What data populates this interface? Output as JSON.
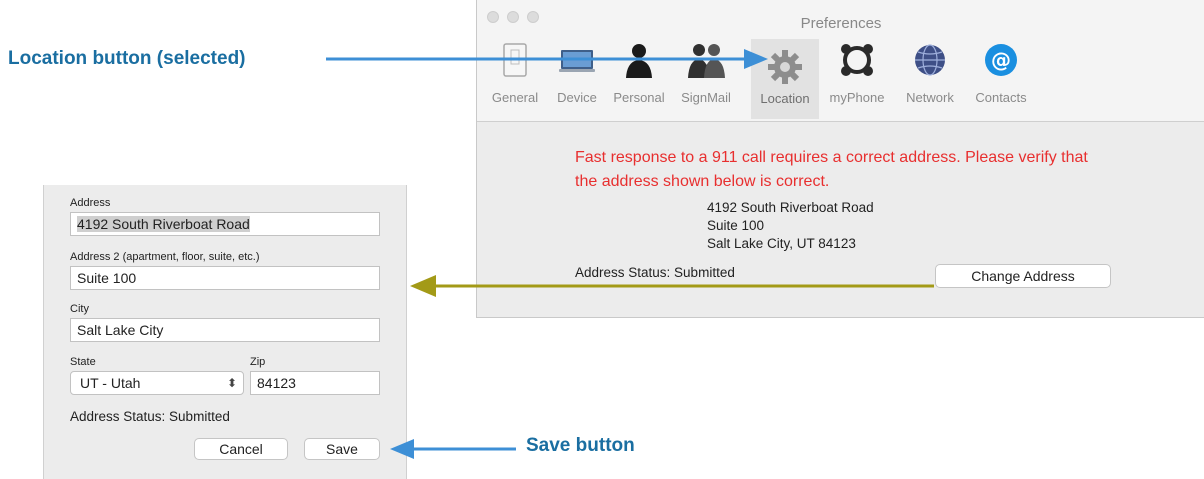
{
  "callouts": {
    "location_label": "Location button (selected)",
    "save_label": "Save button"
  },
  "preferences": {
    "title": "Preferences",
    "toolbar": [
      {
        "label": "General",
        "icon": "general-icon"
      },
      {
        "label": "Device",
        "icon": "device-icon"
      },
      {
        "label": "Personal",
        "icon": "personal-icon"
      },
      {
        "label": "SignMail",
        "icon": "signmail-icon"
      },
      {
        "label": "Location",
        "icon": "gear-icon",
        "selected": true
      },
      {
        "label": "myPhone",
        "icon": "myphone-icon"
      },
      {
        "label": "Network",
        "icon": "globe-icon"
      },
      {
        "label": "Contacts",
        "icon": "at-sign-icon"
      }
    ],
    "warning": "Fast response to a 911 call requires a correct address.  Please verify that the address shown below is correct.",
    "address_line1": "4192 South Riverboat Road",
    "address_line2": "Suite 100",
    "address_line3": "Salt Lake City, UT 84123",
    "status": "Address Status: Submitted",
    "change_button": "Change Address"
  },
  "dialog": {
    "address_label": "Address",
    "address_value": "4192 South Riverboat Road",
    "address2_label": "Address 2 (apartment, floor, suite, etc.)",
    "address2_value": "Suite 100",
    "city_label": "City",
    "city_value": "Salt Lake City",
    "state_label": "State",
    "state_value": "UT - Utah",
    "zip_label": "Zip",
    "zip_value": "84123",
    "status": "Address Status: Submitted",
    "cancel_button": "Cancel",
    "save_button": "Save"
  },
  "colors": {
    "callout_text": "#1a6ea1",
    "blue_arrow": "#3d8fd6",
    "olive_arrow": "#a39a17",
    "warning_text": "#e82f2f"
  }
}
